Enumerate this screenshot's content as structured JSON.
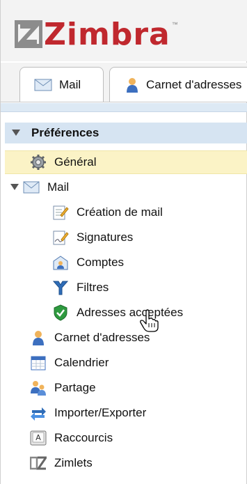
{
  "app": {
    "logo_text": "Zimbra"
  },
  "tabs": [
    {
      "label": "Mail",
      "icon": "envelope-icon"
    },
    {
      "label": "Carnet d'adresses",
      "icon": "contact-icon"
    }
  ],
  "tree": {
    "header": "Préférences",
    "items": [
      {
        "key": "general",
        "label": "Général",
        "icon": "gear-icon",
        "selected": true
      },
      {
        "key": "mail",
        "label": "Mail",
        "icon": "envelope-icon",
        "expanded": true
      },
      {
        "key": "composing",
        "label": "Création de mail",
        "icon": "compose-icon"
      },
      {
        "key": "signatures",
        "label": "Signatures",
        "icon": "signature-icon"
      },
      {
        "key": "accounts",
        "label": "Comptes",
        "icon": "accounts-icon"
      },
      {
        "key": "filters",
        "label": "Filtres",
        "icon": "filter-icon"
      },
      {
        "key": "trusted",
        "label": "Adresses acceptées",
        "icon": "shield-check-icon"
      },
      {
        "key": "contacts",
        "label": "Carnet d'adresses",
        "icon": "contact-icon"
      },
      {
        "key": "calendar",
        "label": "Calendrier",
        "icon": "calendar-icon"
      },
      {
        "key": "sharing",
        "label": "Partage",
        "icon": "sharing-icon"
      },
      {
        "key": "importexport",
        "label": "Importer/Exporter",
        "icon": "import-export-icon"
      },
      {
        "key": "shortcuts",
        "label": "Raccourcis",
        "icon": "keyboard-key-icon"
      },
      {
        "key": "zimlets",
        "label": "Zimlets",
        "icon": "zimlet-icon"
      }
    ]
  }
}
